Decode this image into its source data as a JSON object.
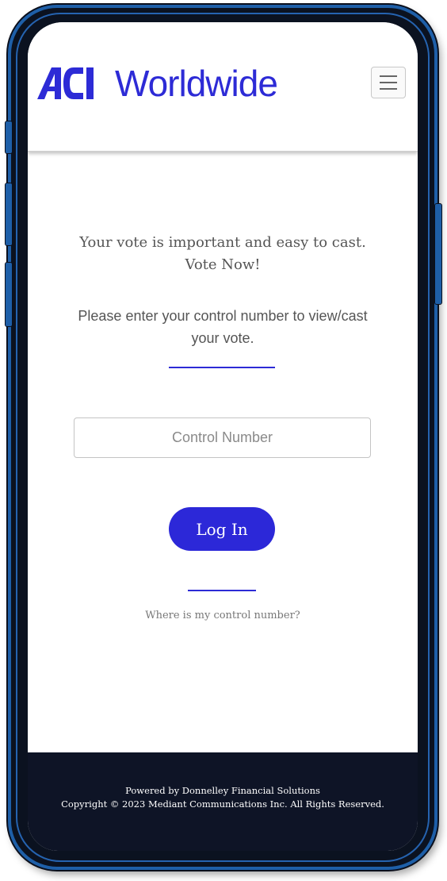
{
  "header": {
    "logo_text": "Worldwide",
    "logo_mark": "ACI",
    "menu_icon": "hamburger-menu-icon",
    "brand_color": "#2d2bd6"
  },
  "main": {
    "headline": "Your vote is important and easy to cast. Vote Now!",
    "instructions": "Please enter your control number to view/cast your vote.",
    "control_number_placeholder": "Control Number",
    "control_number_value": "",
    "login_label": "Log In",
    "help_link": "Where is my control number?",
    "button_color": "#2c28d8"
  },
  "footer": {
    "powered_by": "Powered by Donnelley Financial Solutions",
    "copyright": "Copyright © 2023 Mediant Communications Inc. All Rights Reserved.",
    "background": "#0e1426"
  }
}
